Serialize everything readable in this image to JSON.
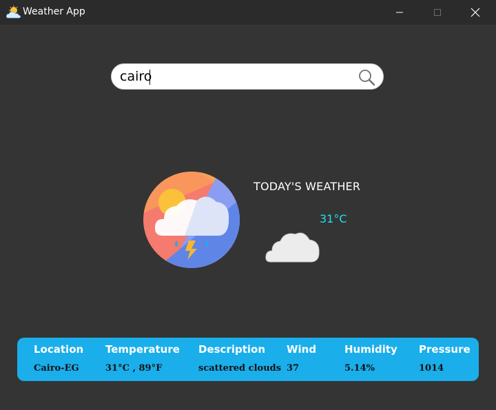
{
  "window": {
    "title": "Weather App",
    "app_icon": "sun-cloud-icon"
  },
  "search": {
    "value": "cairo",
    "icon": "search-icon"
  },
  "weather": {
    "heading": "TODAY'S WEATHER",
    "temperature": "31°C",
    "main_icon": "storm-cloud-sun-icon",
    "condition_icon": "cloud-icon"
  },
  "info": {
    "columns": [
      {
        "header": "Location",
        "value": "Cairo-EG"
      },
      {
        "header": "Temperature",
        "value": "31°C , 89°F"
      },
      {
        "header": "Description",
        "value": "scattered clouds"
      },
      {
        "header": "Wind",
        "value": "37"
      },
      {
        "header": "Humidity",
        "value": "5.14%"
      },
      {
        "header": "Pressure",
        "value": "1014"
      }
    ]
  },
  "colors": {
    "background": "#343434",
    "panel": "#1aaeeb",
    "temp_accent": "#22e0ef"
  }
}
